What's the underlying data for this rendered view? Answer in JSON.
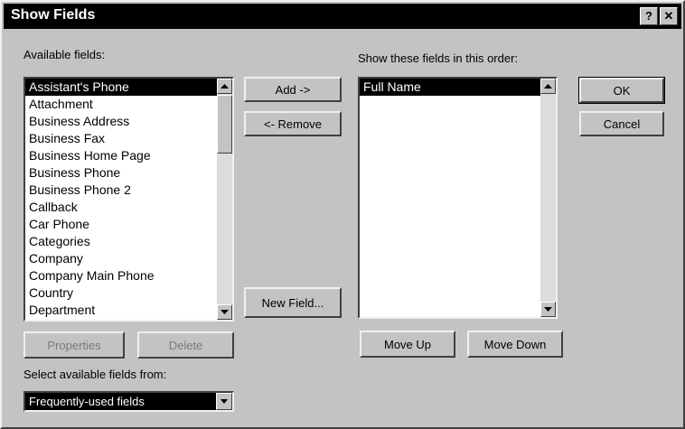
{
  "window": {
    "title": "Show Fields",
    "help_label": "?",
    "close_label": "✕"
  },
  "available": {
    "label": "Available fields:",
    "items": [
      "Assistant's Phone",
      "Attachment",
      "Business Address",
      "Business Fax",
      "Business Home Page",
      "Business Phone",
      "Business Phone 2",
      "Callback",
      "Car Phone",
      "Categories",
      "Company",
      "Company Main Phone",
      "Country",
      "Department"
    ],
    "selected_index": 0
  },
  "shown": {
    "label": "Show these fields in this order:",
    "items": [
      "Full Name"
    ],
    "selected_index": 0
  },
  "buttons": {
    "add": "Add ->",
    "remove": "<- Remove",
    "new_field": "New Field...",
    "properties": "Properties",
    "delete": "Delete",
    "move_up": "Move Up",
    "move_down": "Move Down",
    "ok": "OK",
    "cancel": "Cancel"
  },
  "source": {
    "label": "Select available fields from:",
    "value": "Frequently-used fields"
  },
  "colors": {
    "dialog_bg": "#c3c3c3",
    "titlebar": "#000000",
    "selection": "#000000"
  }
}
